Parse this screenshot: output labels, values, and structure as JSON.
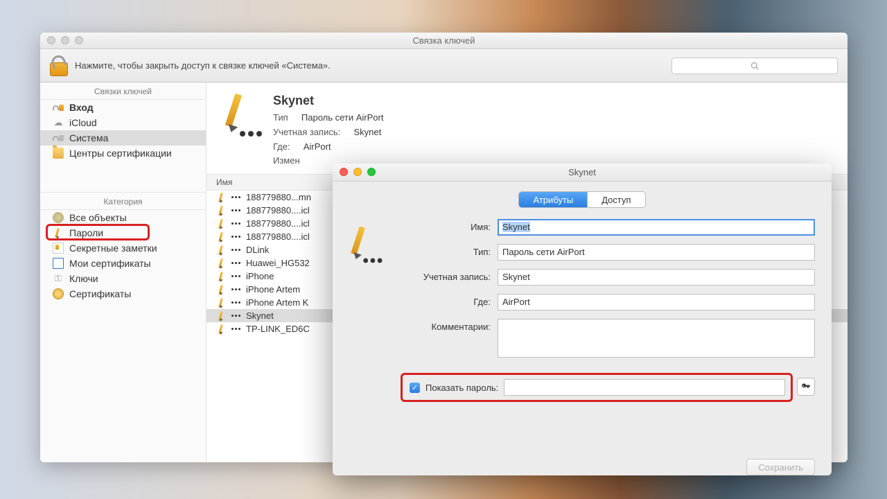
{
  "main": {
    "title": "Связка ключей",
    "toolbarText": "Нажмите, чтобы закрыть доступ к связке ключей «Система».",
    "searchPlaceholder": ""
  },
  "sidebar": {
    "keychainsHeader": "Связки ключей",
    "keychains": [
      {
        "label": "Вход",
        "icon": "lock"
      },
      {
        "label": "iCloud",
        "icon": "cloud"
      },
      {
        "label": "Система",
        "icon": "graylock",
        "selected": true
      },
      {
        "label": "Центры сертификации",
        "icon": "folder"
      }
    ],
    "categoryHeader": "Категория",
    "categories": [
      {
        "label": "Все объекты",
        "icon": "sphere"
      },
      {
        "label": "Пароли",
        "icon": "pencil",
        "highlighted": true
      },
      {
        "label": "Секретные заметки",
        "icon": "note"
      },
      {
        "label": "Мои сертификаты",
        "icon": "cert"
      },
      {
        "label": "Ключи",
        "icon": "key"
      },
      {
        "label": "Сертификаты",
        "icon": "award"
      }
    ]
  },
  "detail": {
    "name": "Skynet",
    "rows": {
      "typeLabel": "Тип",
      "typeValue": "Пароль сети AirPort",
      "acctLabel": "Учетная запись:",
      "acctValue": "Skynet",
      "whereLabel": "Где:",
      "whereValue": "AirPort",
      "modLabel": "Измен"
    },
    "listHeader": "Имя",
    "items": [
      "188779880...mn",
      "188779880....icl",
      "188779880....icl",
      "188779880....icl",
      "DLink",
      "Huawei_HG532",
      "iPhone",
      "iPhone Artem",
      "iPhone Artem K",
      "Skynet",
      "TP-LINK_ED6C"
    ],
    "selectedIndex": 9
  },
  "modal": {
    "title": "Skynet",
    "tabs": {
      "attributes": "Атрибуты",
      "access": "Доступ"
    },
    "fields": {
      "nameLabel": "Имя:",
      "nameValue": "Skynet",
      "typeLabel": "Тип:",
      "typeValue": "Пароль сети AirPort",
      "acctLabel": "Учетная запись:",
      "acctValue": "Skynet",
      "whereLabel": "Где:",
      "whereValue": "AirPort",
      "commentsLabel": "Комментарии:",
      "commentsValue": ""
    },
    "showPasswordLabel": "Показать пароль:",
    "passwordValue": "",
    "saveLabel": "Сохранить"
  }
}
